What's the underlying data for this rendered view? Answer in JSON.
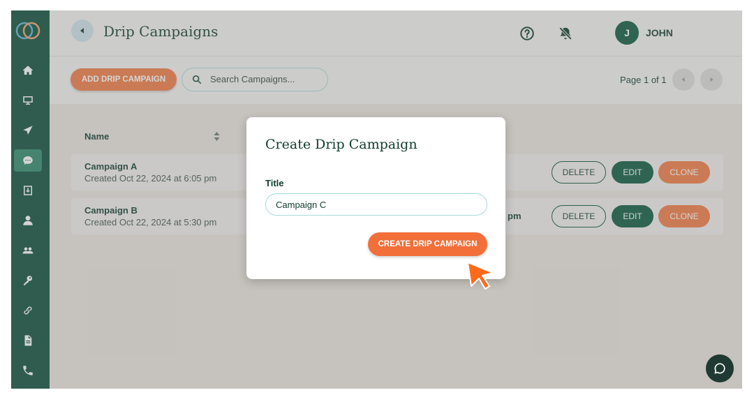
{
  "header": {
    "title": "Drip Campaigns",
    "user_initial": "J",
    "user_name": "JOHN"
  },
  "toolbar": {
    "add_label": "ADD DRIP CAMPAIGN",
    "search_placeholder": "Search Campaigns...",
    "page_info": "Page 1 of 1"
  },
  "table": {
    "column_name": "Name",
    "rows": [
      {
        "name": "Campaign A",
        "created": "Created Oct 22, 2024 at 6:05 pm",
        "extra": ""
      },
      {
        "name": "Campaign B",
        "created": "Created Oct 22, 2024 at 5:30 pm",
        "extra": "pm"
      }
    ],
    "actions": {
      "delete": "DELETE",
      "edit": "EDIT",
      "clone": "CLONE"
    }
  },
  "modal": {
    "title": "Create Drip Campaign",
    "field_label": "Title",
    "field_value": "Campaign C",
    "submit_label": "CREATE DRIP CAMPAIGN"
  },
  "sidebar": {
    "icons": [
      "home-icon",
      "monitor-icon",
      "send-icon",
      "chat-bubble-icon",
      "inbox-icon",
      "user-icon",
      "users-icon",
      "key-icon",
      "link-icon",
      "document-icon",
      "phone-icon"
    ],
    "active_index": 3
  },
  "colors": {
    "sidebar": "#0d4f3a",
    "accent_orange": "#f07c45",
    "primary_green": "#0d5a40",
    "text_dark": "#103c2e"
  }
}
